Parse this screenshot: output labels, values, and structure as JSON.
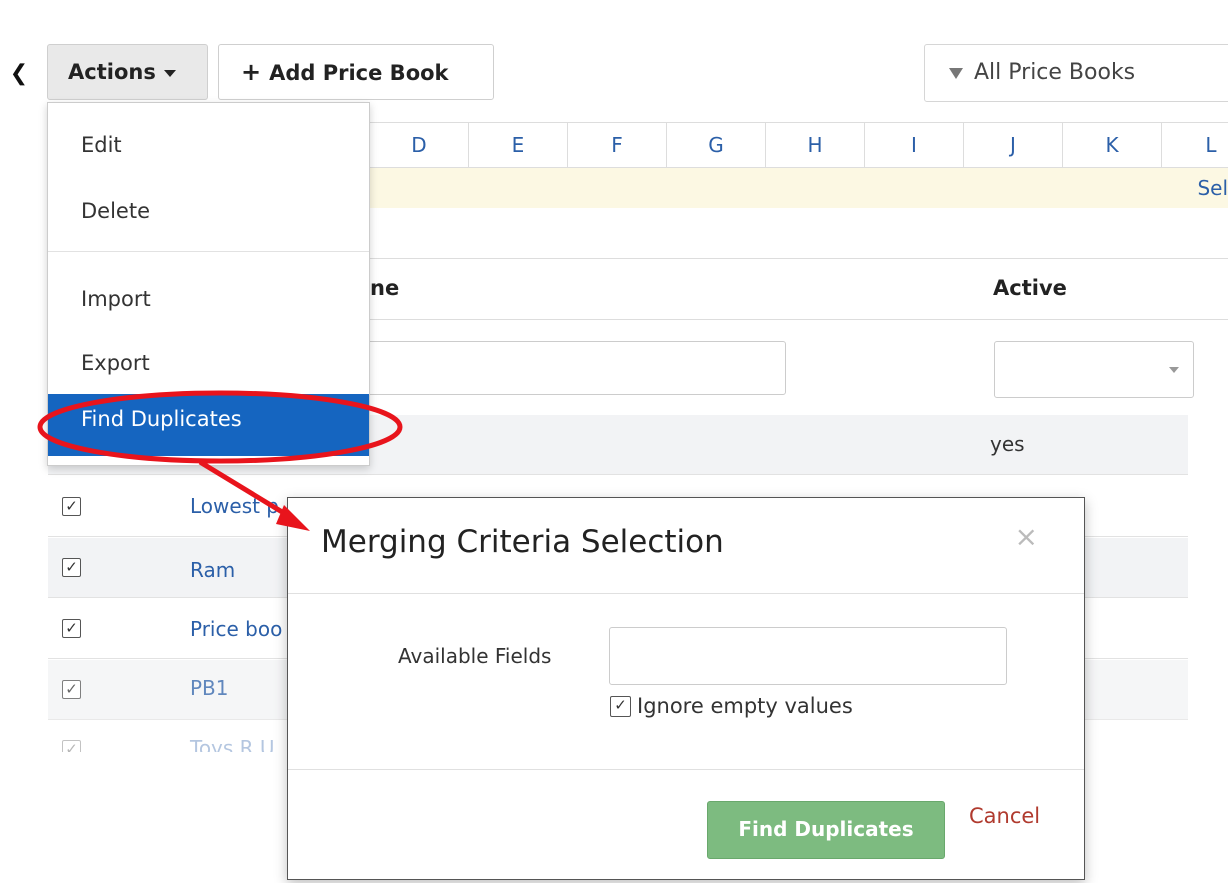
{
  "toolbar": {
    "back_icon": "chevron-left-icon",
    "actions_label": "Actions",
    "add_label": "Add Price Book",
    "filter_label": "All Price Books"
  },
  "alphabet": [
    "D",
    "E",
    "F",
    "G",
    "H",
    "I",
    "J",
    "K",
    "L"
  ],
  "select_link": "Sel",
  "table": {
    "columns": [
      "ne",
      "Active"
    ],
    "rows": [
      {
        "name": "",
        "active": "yes",
        "checked": false
      },
      {
        "name": "Lowest p",
        "active": "",
        "checked": true
      },
      {
        "name": "Ram",
        "active": "",
        "checked": true
      },
      {
        "name": "Price boo",
        "active": "",
        "checked": true
      },
      {
        "name": "PB1",
        "active": "",
        "checked": true
      },
      {
        "name": "Toys R U",
        "active": "",
        "checked": true
      }
    ]
  },
  "menu": {
    "items": [
      "Edit",
      "Delete",
      "Import",
      "Export",
      "Find Duplicates"
    ],
    "active_item": "Find Duplicates"
  },
  "modal": {
    "title": "Merging Criteria Selection",
    "close_icon": "close-icon",
    "fields_label": "Available Fields",
    "fields_value": "",
    "ignore_label": "Ignore empty values",
    "ignore_checked": true,
    "find_button": "Find Duplicates",
    "cancel": "Cancel"
  },
  "colors": {
    "menu_active_bg": "#1565c0",
    "find_button_bg": "#7dbb80",
    "cancel": "#b03a2e",
    "annotation": "#e8141c",
    "link": "#2b5fa8"
  }
}
